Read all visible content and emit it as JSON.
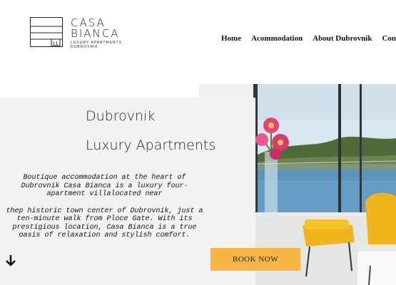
{
  "brand": {
    "line1": "CASA",
    "line2": "BIANCA",
    "tagline1": "LUXURY APARTMENTS",
    "tagline2": "DUBROVNIK",
    "mark_letters": "LL"
  },
  "nav": {
    "items": [
      "Home",
      "Acommodation",
      "About Dubrovnik",
      "Contact"
    ]
  },
  "hero": {
    "title_line1": "Dubrovnik",
    "title_line2": "Luxury Apartments",
    "paragraph1": "Boutique accommodation at the heart of Dubrovnik Casa Bianca is a luxury four-apartment villalocated near",
    "paragraph2": "thep historic town center of Dubrovnik, just a ten-minute walk from Ploce Gate. With its prestigious location, Casa Bianca is a true oasis of relaxation and stylish comfort.",
    "button_label": "BOOK NOW",
    "scroll_icon": "arrow-down-icon"
  },
  "colors": {
    "panel_bg": "#f2f2f2",
    "button_bg": "#f7b643",
    "chair_yellow": "#f2b41c",
    "sea": "#3d7fb2"
  }
}
